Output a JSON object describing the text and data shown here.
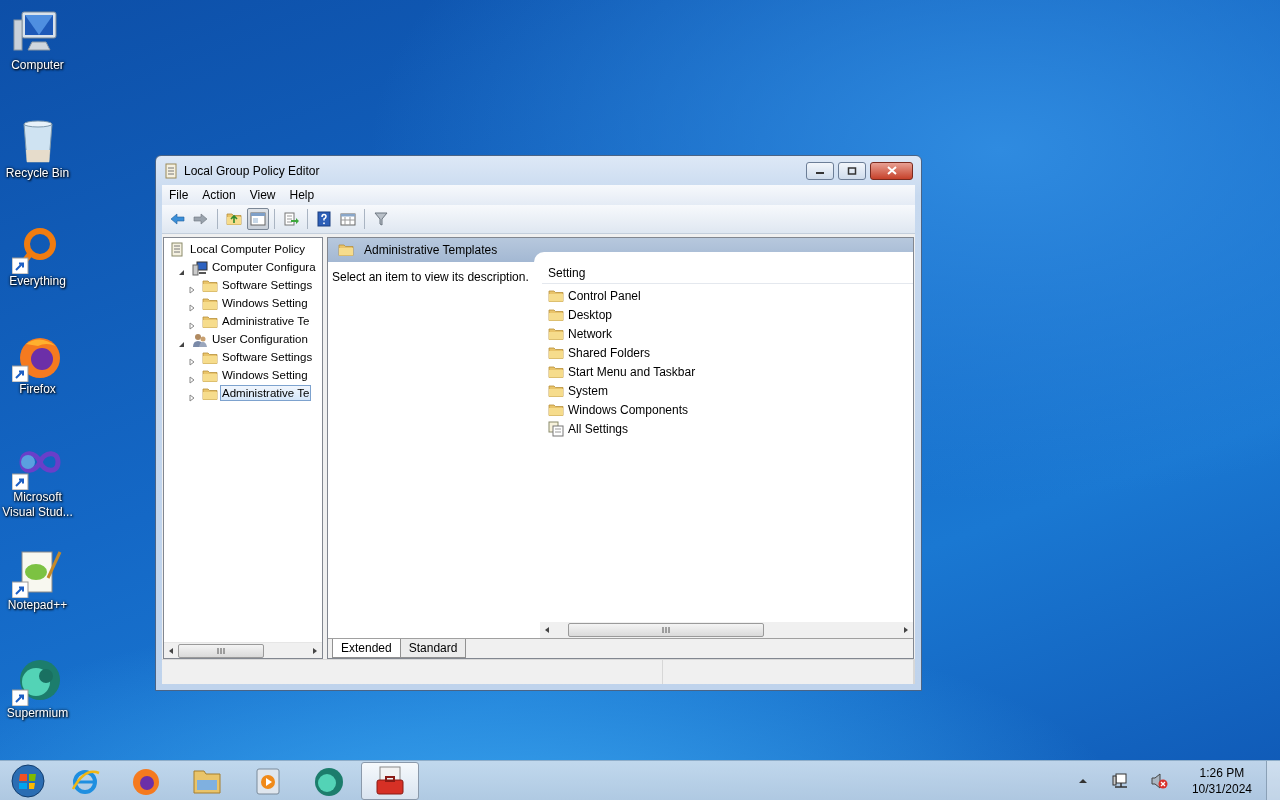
{
  "desktop_icons": [
    {
      "label": "Computer",
      "kind": "computer",
      "shortcut": false
    },
    {
      "label": "Recycle Bin",
      "kind": "recycle",
      "shortcut": false
    },
    {
      "label": "Everything",
      "kind": "ring",
      "shortcut": true
    },
    {
      "label": "Firefox",
      "kind": "firefox",
      "shortcut": true
    },
    {
      "label": "Microsoft Visual Stud...",
      "kind": "infinity",
      "shortcut": true
    },
    {
      "label": "Notepad++",
      "kind": "notepad",
      "shortcut": true
    },
    {
      "label": "Supermium",
      "kind": "supermium",
      "shortcut": true
    }
  ],
  "window": {
    "title": "Local Group Policy Editor",
    "menu": [
      "File",
      "Action",
      "View",
      "Help"
    ],
    "tree": [
      {
        "label": "Local Computer Policy",
        "kind": "policy",
        "selected": false,
        "children": [
          {
            "label": "Computer Configura",
            "kind": "computer",
            "expanded": true,
            "selected": false,
            "children": [
              {
                "label": "Software Settings",
                "kind": "folder",
                "expanded": false,
                "selected": false
              },
              {
                "label": "Windows Setting",
                "kind": "folder",
                "expanded": false,
                "selected": false
              },
              {
                "label": "Administrative Te",
                "kind": "folder",
                "expanded": false,
                "selected": false
              }
            ]
          },
          {
            "label": "User Configuration",
            "kind": "user",
            "expanded": true,
            "selected": false,
            "children": [
              {
                "label": "Software Settings",
                "kind": "folder",
                "expanded": false,
                "selected": false
              },
              {
                "label": "Windows Setting",
                "kind": "folder",
                "expanded": false,
                "selected": false
              },
              {
                "label": "Administrative Te",
                "kind": "folder",
                "expanded": false,
                "selected": true
              }
            ]
          }
        ]
      }
    ],
    "header": "Administrative Templates",
    "description": "Select an item to view its description.",
    "column": "Setting",
    "items": [
      {
        "label": "Control Panel",
        "kind": "folder"
      },
      {
        "label": "Desktop",
        "kind": "folder"
      },
      {
        "label": "Network",
        "kind": "folder"
      },
      {
        "label": "Shared Folders",
        "kind": "folder"
      },
      {
        "label": "Start Menu and Taskbar",
        "kind": "folder"
      },
      {
        "label": "System",
        "kind": "folder"
      },
      {
        "label": "Windows Components",
        "kind": "folder"
      },
      {
        "label": "All Settings",
        "kind": "settings"
      }
    ],
    "tabs": [
      {
        "label": "Extended",
        "selected": true
      },
      {
        "label": "Standard",
        "selected": false
      }
    ]
  },
  "taskbar": {
    "apps": [
      {
        "kind": "ie",
        "active": false
      },
      {
        "kind": "firefox",
        "active": false
      },
      {
        "kind": "explorer",
        "active": false
      },
      {
        "kind": "media",
        "active": false
      },
      {
        "kind": "supermium",
        "active": false
      },
      {
        "kind": "toolbox",
        "active": true
      }
    ],
    "time": "1:26 PM",
    "date": "10/31/2024"
  }
}
